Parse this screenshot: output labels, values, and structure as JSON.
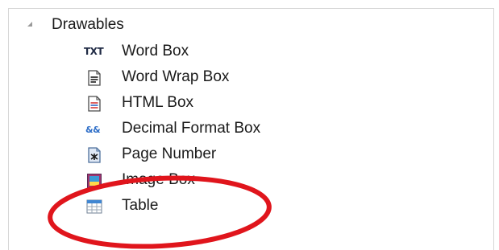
{
  "palette": {
    "category_label": "Drawables",
    "items": [
      {
        "label": "Word Box",
        "icon": "txt-icon"
      },
      {
        "label": "Word Wrap Box",
        "icon": "word-wrap-icon"
      },
      {
        "label": "HTML Box",
        "icon": "html-box-icon"
      },
      {
        "label": "Decimal Format Box",
        "icon": "decimal-format-icon"
      },
      {
        "label": "Page Number",
        "icon": "page-number-icon"
      },
      {
        "label": "Image Box",
        "icon": "image-box-icon"
      },
      {
        "label": "Table",
        "icon": "table-icon"
      }
    ],
    "icon_text": {
      "txt": "TXT",
      "decimal": "&&"
    }
  },
  "annotation": {
    "color": "#e0151c",
    "highlighted_item": "Image Box"
  }
}
